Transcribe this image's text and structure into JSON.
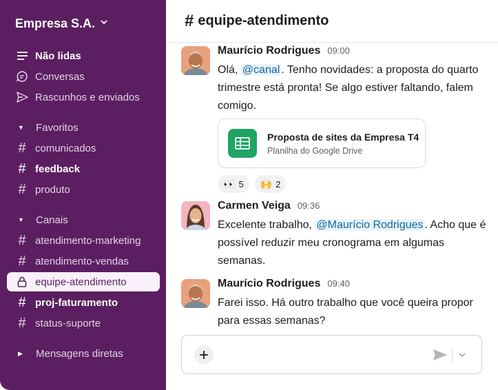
{
  "workspace": {
    "name": "Empresa S.A."
  },
  "sidebar": {
    "primary": [
      {
        "label": "Não lidas",
        "icon": "unread-lines-icon"
      },
      {
        "label": "Conversas",
        "icon": "threads-icon"
      },
      {
        "label": "Rascunhos e enviados",
        "icon": "send-icon"
      }
    ],
    "favorites": {
      "title": "Favoritos",
      "items": [
        {
          "label": "comunicados"
        },
        {
          "label": "feedback"
        },
        {
          "label": "produto"
        }
      ]
    },
    "channels": {
      "title": "Canais",
      "items": [
        {
          "label": "atendimento-marketing"
        },
        {
          "label": "atendimento-vendas"
        },
        {
          "label": "equipe-atendimento"
        },
        {
          "label": "proj-faturamento"
        },
        {
          "label": "status-suporte"
        }
      ]
    },
    "dms": {
      "title": "Mensagens diretas"
    }
  },
  "header": {
    "hash": "#",
    "title": "equipe-atendimento"
  },
  "messages": [
    {
      "author": "Maurício Rodrigues",
      "time": "09:00",
      "text_before": "Olá, ",
      "mention": "@canal",
      "text_after": ". Tenho novidades: a proposta do quarto trimestre está pronta! Se algo estiver faltando, falem comigo."
    },
    {
      "author": "Carmen Veiga",
      "time": "09:36",
      "text_before": "Excelente trabalho, ",
      "mention": "@Maurício Rodrigues",
      "text_after": ". Acho que é possível reduzir meu cronograma em algumas semanas."
    },
    {
      "author": "Maurício Rodrigues",
      "time": "09:40",
      "text": "Farei isso. Há outro trabalho que você queira propor para essas semanas?"
    }
  ],
  "attachment": {
    "title": "Proposta de sites da Empresa T4",
    "subtitle": "Planilha do Google Drive",
    "color": "#1fa463"
  },
  "reactions": [
    {
      "emoji": "👀",
      "count": "5"
    },
    {
      "emoji": "🙌",
      "count": "2"
    }
  ],
  "composer": {
    "placeholder": ""
  },
  "colors": {
    "sidebar": "#5b1f61",
    "mention": "#1264a3",
    "active_item": "#f8f1f9"
  }
}
